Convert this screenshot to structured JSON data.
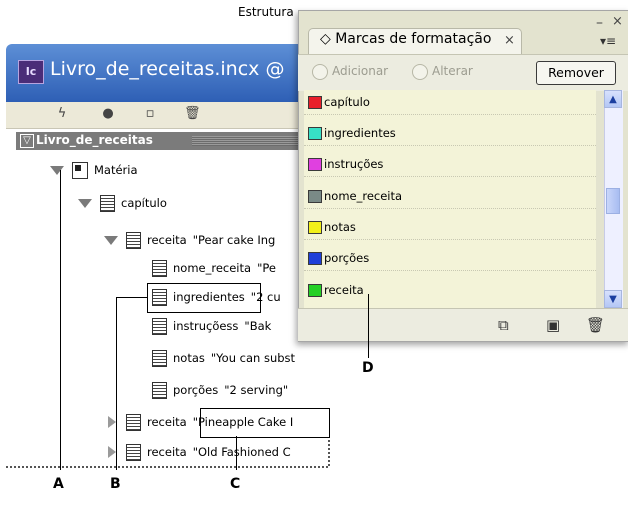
{
  "window": {
    "app_icon": "Ic",
    "title": "Livro_de_receitas.incx @",
    "toolbar_label": "Estrutura",
    "toolbar_icons": [
      "lightning-icon",
      "record-icon",
      "new-element-icon",
      "trash-icon"
    ]
  },
  "tree": {
    "root": "Livro_de_receitas",
    "rows": [
      {
        "label": "Matéria",
        "value": ""
      },
      {
        "label": "capítulo",
        "value": ""
      },
      {
        "label": "receita",
        "value": "\"Pear cake Ing"
      },
      {
        "label": "nome_receita",
        "value": "\"Pe"
      },
      {
        "label": "ingredientes",
        "value": "\"2 cu"
      },
      {
        "label": "instruçõess",
        "value": "\"Bak"
      },
      {
        "label": "notas",
        "value": "\"You can subst"
      },
      {
        "label": "porções",
        "value": "\"2 serving\""
      },
      {
        "label": "receita",
        "value": "\"Pineapple Cake I"
      },
      {
        "label": "receita",
        "value": "\"Old Fashioned C"
      }
    ]
  },
  "panel": {
    "tab_label": "◇ Marcas de formatação",
    "tab_close": "×",
    "minimize": "–",
    "close": "×",
    "menu": "▾≡",
    "option_add": "Adicionar",
    "option_change": "Alterar",
    "remove_button": "Remover",
    "tags": [
      {
        "name": "capítulo",
        "color": "#e8202a"
      },
      {
        "name": "ingredientes",
        "color": "#37e0c6"
      },
      {
        "name": "instruções",
        "color": "#e040e0"
      },
      {
        "name": "nome_receita",
        "color": "#7a8a86"
      },
      {
        "name": "notas",
        "color": "#f2f01a"
      },
      {
        "name": "porções",
        "color": "#1f3fd8"
      },
      {
        "name": "receita",
        "color": "#25d025"
      }
    ],
    "footer_icons": [
      "map-tags-icon",
      "new-tag-icon",
      "delete-tag-icon"
    ]
  },
  "callouts": {
    "a": "A",
    "b": "B",
    "c": "C",
    "d": "D"
  }
}
